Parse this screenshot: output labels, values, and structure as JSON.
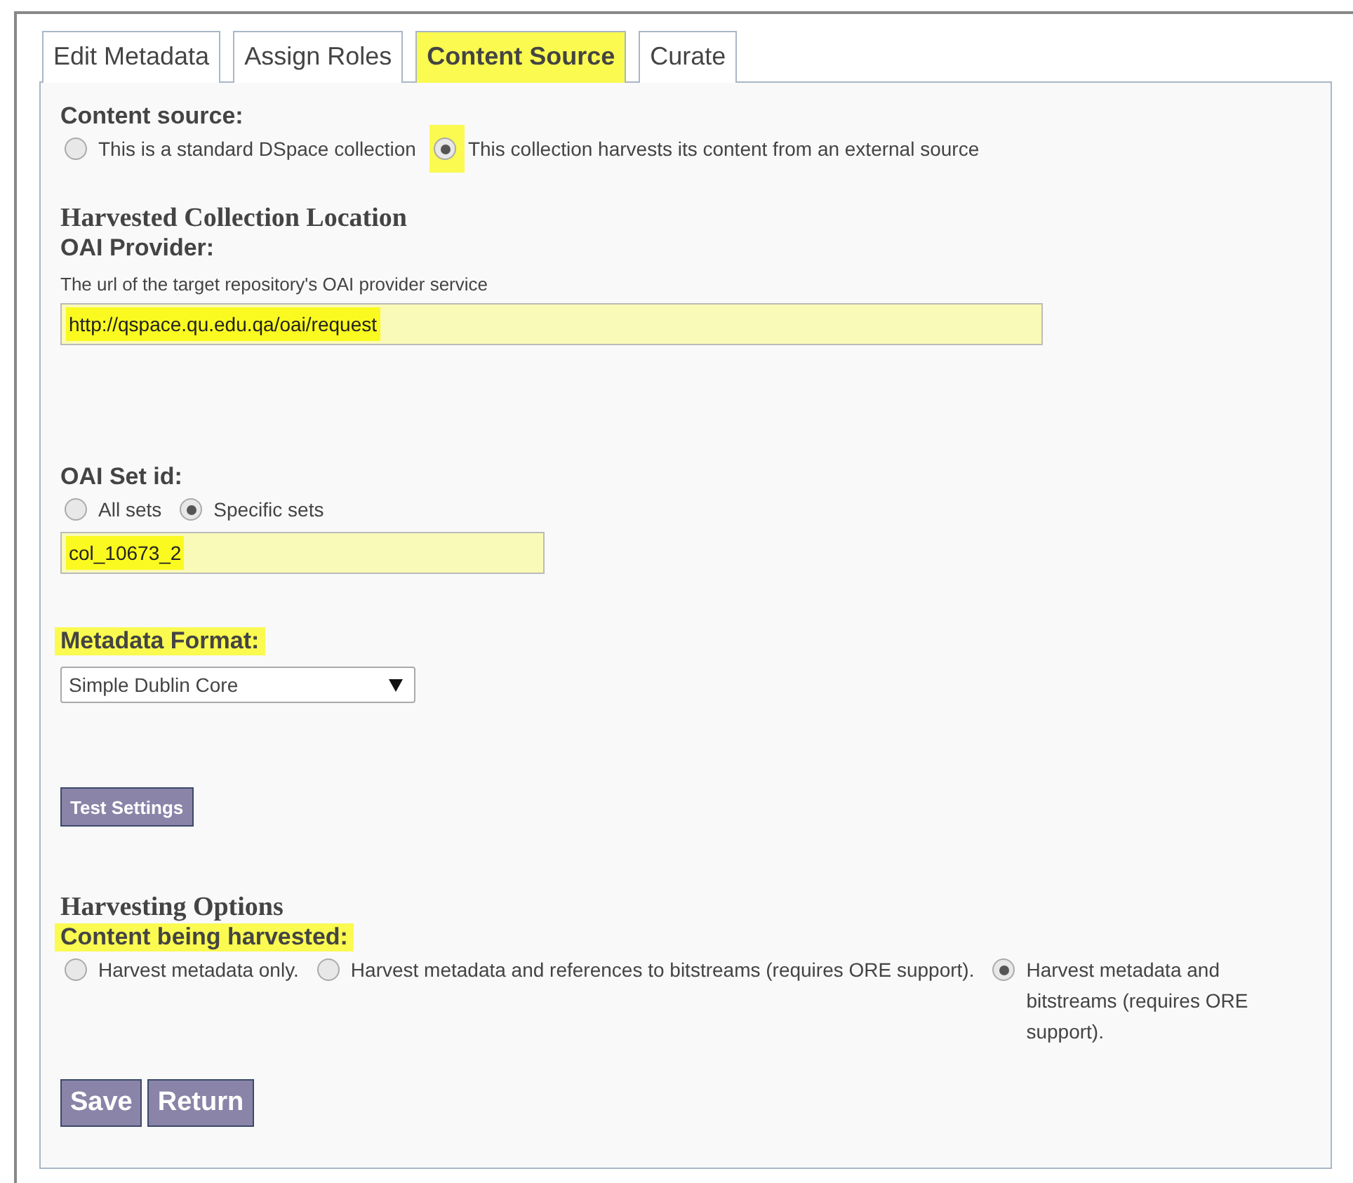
{
  "tabs": [
    {
      "label": "Edit Metadata",
      "selected": false,
      "highlighted": false
    },
    {
      "label": "Assign Roles",
      "selected": false,
      "highlighted": false
    },
    {
      "label": "Content Source",
      "selected": true,
      "highlighted": true
    },
    {
      "label": "Curate",
      "selected": false,
      "highlighted": false
    }
  ],
  "content_source": {
    "label": "Content source:",
    "options": [
      {
        "label": "This is a standard DSpace collection",
        "selected": false,
        "highlighted": false
      },
      {
        "label": "This collection harvests its content from an external source",
        "selected": true,
        "highlighted": true
      }
    ]
  },
  "location": {
    "heading": "Harvested Collection Location",
    "provider_label": "OAI Provider:",
    "provider_help": "The url of the target repository's OAI provider service",
    "provider_field": {
      "value": "http://qspace.qu.edu.qa/oai/request",
      "highlighted": true
    },
    "set_label": "OAI Set id:",
    "set_options": [
      {
        "label": "All sets",
        "selected": false,
        "highlighted": false
      },
      {
        "label": "Specific sets",
        "selected": true,
        "highlighted": false
      }
    ],
    "set_field": {
      "value": "col_10673_2",
      "highlighted": true
    },
    "format_label": {
      "text": "Metadata Format:",
      "highlighted": true
    },
    "format_select": "Simple Dublin Core",
    "test_button": "Test Settings"
  },
  "harvesting": {
    "heading": "Harvesting Options",
    "content_label": {
      "text": "Content being harvested:",
      "highlighted": true
    },
    "options": [
      {
        "label": "Harvest metadata only.",
        "selected": false,
        "highlighted": false
      },
      {
        "label": "Harvest metadata and references to bitstreams (requires ORE support).",
        "selected": false,
        "highlighted": false
      },
      {
        "label": "Harvest metadata and bitstreams (requires ORE support).",
        "selected": true,
        "highlighted": false
      }
    ]
  },
  "buttons": [
    "Save",
    "Return"
  ]
}
